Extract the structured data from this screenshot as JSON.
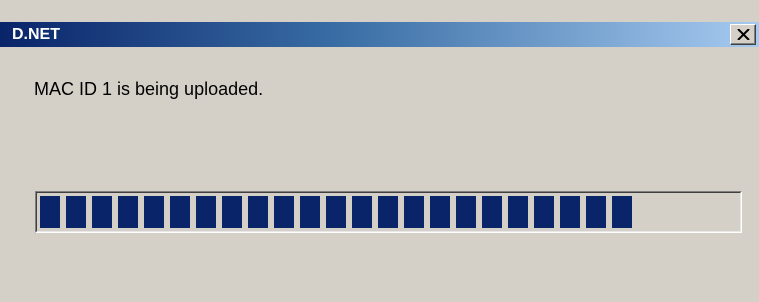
{
  "window": {
    "title": "D.NET",
    "message": "MAC ID 1 is being uploaded."
  },
  "progress": {
    "fraction": 0.86,
    "total_blocks": 27,
    "filled_blocks": 23,
    "color": "#0a246a"
  },
  "icons": {
    "close": "close-icon"
  }
}
